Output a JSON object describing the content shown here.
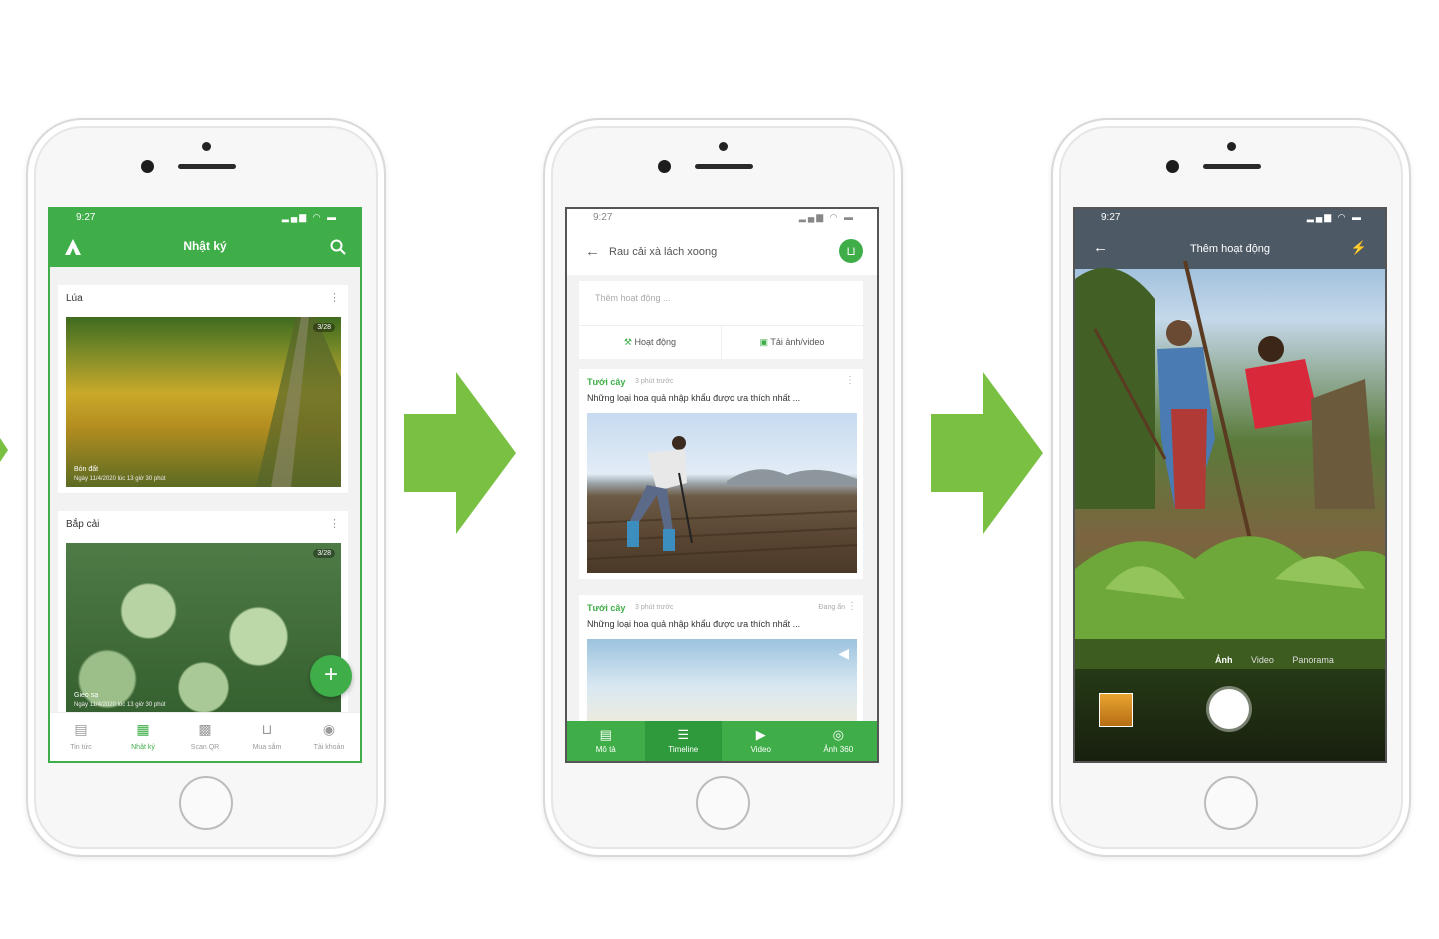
{
  "colors": {
    "brand_green": "#3fae49",
    "arrow_green": "#7ac143"
  },
  "phone1": {
    "status_time": "9:27",
    "app_title": "Nhật ký",
    "cards": [
      {
        "title": "Lúa",
        "badge": "3/28",
        "caption": "Bón đất",
        "sub": "Ngày 11/4/2020 lúc 13 giờ 30 phút"
      },
      {
        "title": "Bắp cải",
        "badge": "3/28",
        "caption": "Gieo sạ",
        "sub": "Ngày 11/4/2020 lúc 13 giờ 30 phút"
      }
    ],
    "nav": [
      "Tin tức",
      "Nhật ký",
      "Scan QR",
      "Mua sắm",
      "Tài khoản"
    ]
  },
  "phone2": {
    "status_time": "9:27",
    "header_title": "Rau cải xà lách xoong",
    "add_placeholder": "Thêm hoạt động ...",
    "actions": [
      "Hoạt động",
      "Tải ảnh/video"
    ],
    "posts": [
      {
        "tag": "Tưới cây",
        "time": "3 phút trước",
        "text": "Những loại hoa quả nhập khẩu được ưa thích nhất ...",
        "status": ""
      },
      {
        "tag": "Tưới cây",
        "time": "3 phút trước",
        "text": "Những loại hoa quả nhập khẩu được ưa thích nhất ...",
        "status": "Đang ẩn"
      }
    ],
    "tabs": [
      "Mô tả",
      "Timeline",
      "Video",
      "Ảnh 360"
    ]
  },
  "phone3": {
    "status_time": "9:27",
    "header_title": "Thêm hoạt động",
    "modes": [
      "Ảnh",
      "Video",
      "Panorama"
    ]
  }
}
